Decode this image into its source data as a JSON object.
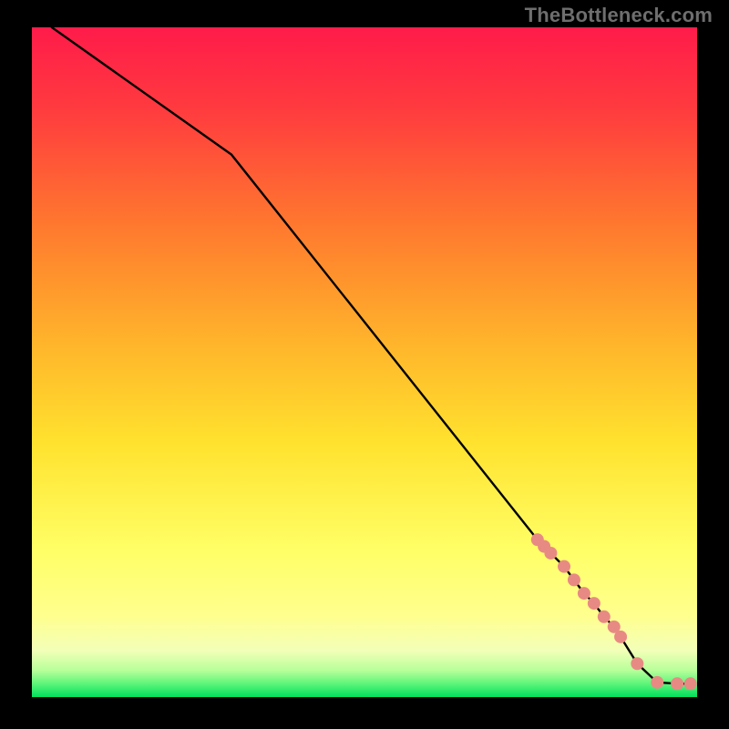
{
  "watermark": "TheBottleneck.com",
  "chart_data": {
    "type": "line",
    "title": "",
    "xlabel": "",
    "ylabel": "",
    "xlim": [
      0,
      100
    ],
    "ylim": [
      0,
      100
    ],
    "grid": false,
    "legend": false,
    "background_gradient": {
      "top": "#ff1b4a",
      "upper_mid": "#ff7a2e",
      "mid": "#ffe22e",
      "lower": "#ffff8f",
      "bottom": "#00e05a"
    },
    "series": [
      {
        "name": "curve",
        "color": "#000000",
        "x": [
          3,
          30,
          76,
          78,
          80,
          81.5,
          83,
          84.5,
          86,
          87.5,
          88.5,
          91,
          94,
          97,
          99
        ],
        "y": [
          100,
          81,
          23.5,
          21.5,
          19.5,
          17.5,
          15.5,
          14,
          12,
          10.5,
          9,
          5,
          2.2,
          2.0,
          2.0
        ]
      }
    ],
    "markers": {
      "name": "highlighted-points",
      "color": "#e88a84",
      "radius": 7,
      "points": [
        {
          "x": 76,
          "y": 23.5
        },
        {
          "x": 77,
          "y": 22.5
        },
        {
          "x": 78,
          "y": 21.5
        },
        {
          "x": 80,
          "y": 19.5
        },
        {
          "x": 81.5,
          "y": 17.5
        },
        {
          "x": 83,
          "y": 15.5
        },
        {
          "x": 84.5,
          "y": 14
        },
        {
          "x": 86,
          "y": 12
        },
        {
          "x": 87.5,
          "y": 10.5
        },
        {
          "x": 88.5,
          "y": 9
        },
        {
          "x": 91,
          "y": 5
        },
        {
          "x": 94,
          "y": 2.2
        },
        {
          "x": 97,
          "y": 2.0
        },
        {
          "x": 99,
          "y": 2.0
        }
      ]
    }
  }
}
